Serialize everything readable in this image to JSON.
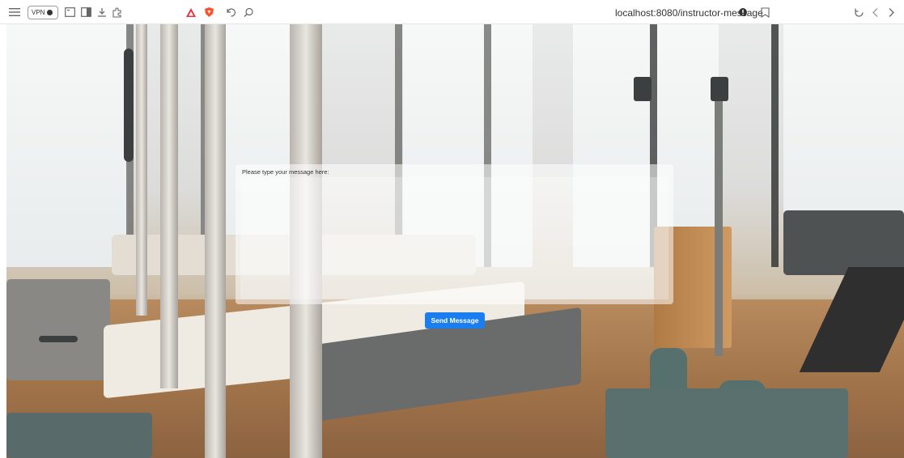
{
  "browser": {
    "url": "localhost:8080/instructor-message",
    "vpn_label": "VPN",
    "icons": [
      "menu-icon",
      "vpn-badge",
      "sidebar-icon",
      "reader-icon",
      "download-icon",
      "extensions-icon",
      "brave-rewards-icon",
      "brave-shields-icon",
      "history-icon",
      "search-icon",
      "private-icon",
      "bookmark-icon",
      "reload-icon",
      "back-icon",
      "forward-icon"
    ]
  },
  "form": {
    "label": "Please type your message here:",
    "textarea_value": "",
    "send_label": "Send Message"
  },
  "colors": {
    "send_button": "#1b7ef0",
    "card_bg": "rgba(255,255,255,0.55)"
  }
}
